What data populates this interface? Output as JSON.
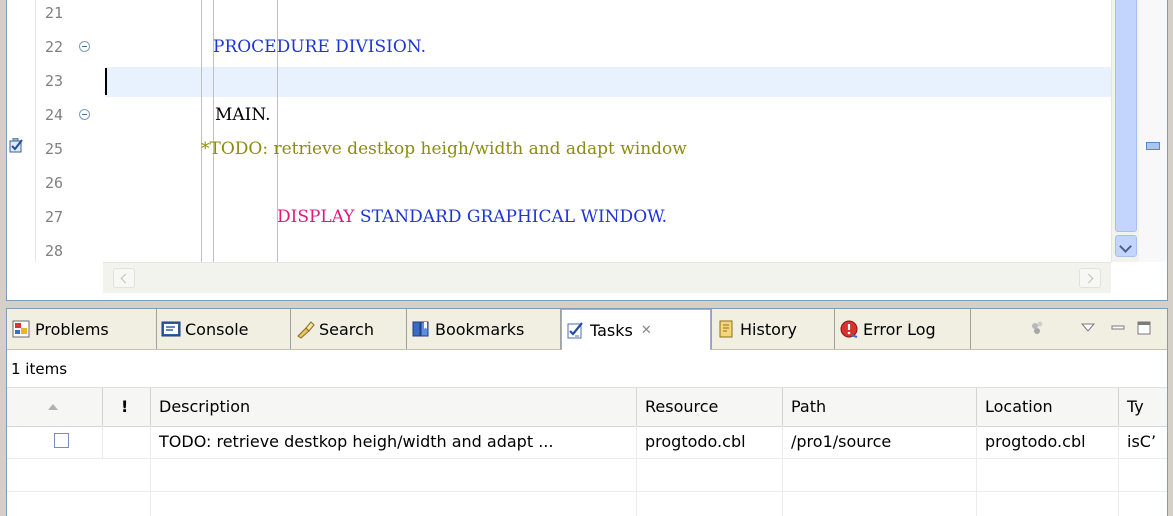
{
  "editor": {
    "line_numbers": [
      "21",
      "22",
      "23",
      "24",
      "25",
      "26",
      "27",
      "28"
    ],
    "code": {
      "l22": "PROCEDURE DIVISION.",
      "l24": "MAIN.",
      "l25": "*TODO: retrieve destkop heigh/width and adapt window",
      "l27_kw": "DISPLAY",
      "l27_rest": " STANDARD GRAPHICAL WINDOW."
    },
    "icons": {
      "task_marker": "task-checkbox-icon",
      "fold": "collapse-fold-icon"
    }
  },
  "view": {
    "tabs": [
      {
        "label": "Problems",
        "icon": "problems-icon"
      },
      {
        "label": "Console",
        "icon": "console-icon"
      },
      {
        "label": "Search",
        "icon": "search-flashlight-icon"
      },
      {
        "label": "Bookmarks",
        "icon": "bookmarks-icon"
      },
      {
        "label": "Tasks",
        "icon": "tasks-icon",
        "active": true
      },
      {
        "label": "History",
        "icon": "history-icon"
      },
      {
        "label": "Error Log",
        "icon": "error-log-icon"
      }
    ],
    "status": "1 items",
    "columns": {
      "priority": "!",
      "description": "Description",
      "resource": "Resource",
      "path": "Path",
      "location": "Location",
      "type": "Ty"
    },
    "rows": [
      {
        "description": "TODO: retrieve destkop heigh/width and adapt ...",
        "resource": "progtodo.cbl",
        "path": "/pro1/source",
        "location": "progtodo.cbl",
        "type": "isC’"
      }
    ]
  },
  "colors": {
    "keyword": "#1d34d6",
    "keyword_display": "#e0187c",
    "comment": "#8c8c10",
    "current_line": "#e8f2fe"
  }
}
